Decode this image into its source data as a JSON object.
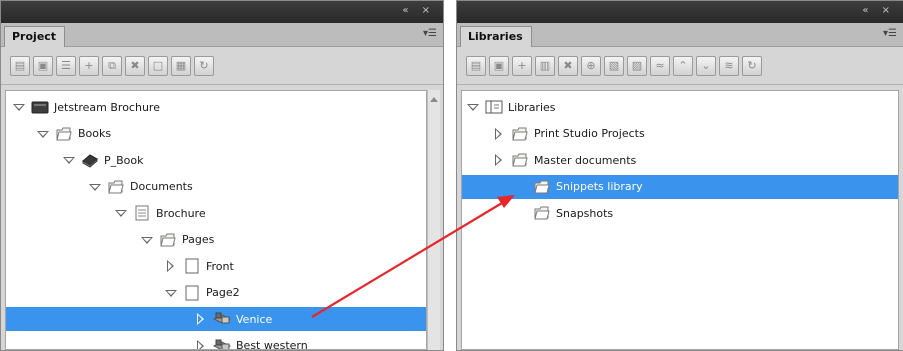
{
  "project_panel": {
    "tab_label": "Project",
    "window_controls": "« ×",
    "toolbar_buttons": [
      "import-icon",
      "save-icon",
      "properties-icon",
      "add-icon",
      "duplicate-icon",
      "delete-icon",
      "new-page-icon",
      "layout-icon",
      "refresh-icon"
    ],
    "tree": [
      {
        "label": "Jetstream Brochure",
        "toggle": "open",
        "icon": "project-icon"
      },
      {
        "label": "Books",
        "toggle": "open",
        "icon": "folder-icon"
      },
      {
        "label": "P_Book",
        "toggle": "open",
        "icon": "book-icon"
      },
      {
        "label": "Documents",
        "toggle": "open",
        "icon": "folder-icon"
      },
      {
        "label": "Brochure",
        "toggle": "open",
        "icon": "document-icon"
      },
      {
        "label": "Pages",
        "toggle": "open",
        "icon": "folder-icon"
      },
      {
        "label": "Front",
        "toggle": "closed",
        "icon": "page-icon"
      },
      {
        "label": "Page2",
        "toggle": "open",
        "icon": "page-icon"
      },
      {
        "label": "Venice",
        "toggle": "closed",
        "icon": "snippet-icon",
        "selected": true
      },
      {
        "label": "Best western",
        "toggle": "closed",
        "icon": "snippet-icon"
      }
    ]
  },
  "libraries_panel": {
    "tab_label": "Libraries",
    "window_controls": "« ×",
    "toolbar_buttons": [
      "import-icon",
      "save-icon",
      "add-icon",
      "library-icon",
      "delete-icon",
      "insert-icon",
      "open-icon",
      "paste-icon",
      "collapse-icon",
      "move-up-icon",
      "move-down-icon",
      "expand-icon",
      "refresh-icon"
    ],
    "tree": [
      {
        "label": "Libraries",
        "toggle": "open",
        "icon": "libraries-icon"
      },
      {
        "label": "Print Studio Projects",
        "toggle": "closed",
        "icon": "folder-icon"
      },
      {
        "label": "Master documents",
        "toggle": "closed",
        "icon": "folder-icon"
      },
      {
        "label": "Snippets library",
        "toggle": "none",
        "icon": "folder-icon",
        "selected": true
      },
      {
        "label": "Snapshots",
        "toggle": "none",
        "icon": "folder-icon"
      }
    ]
  },
  "colors": {
    "selection": "#3a93ec",
    "annotation_arrow": "#e8262a",
    "panel_bg": "#d6d6d6",
    "titlebar": "#333333"
  }
}
